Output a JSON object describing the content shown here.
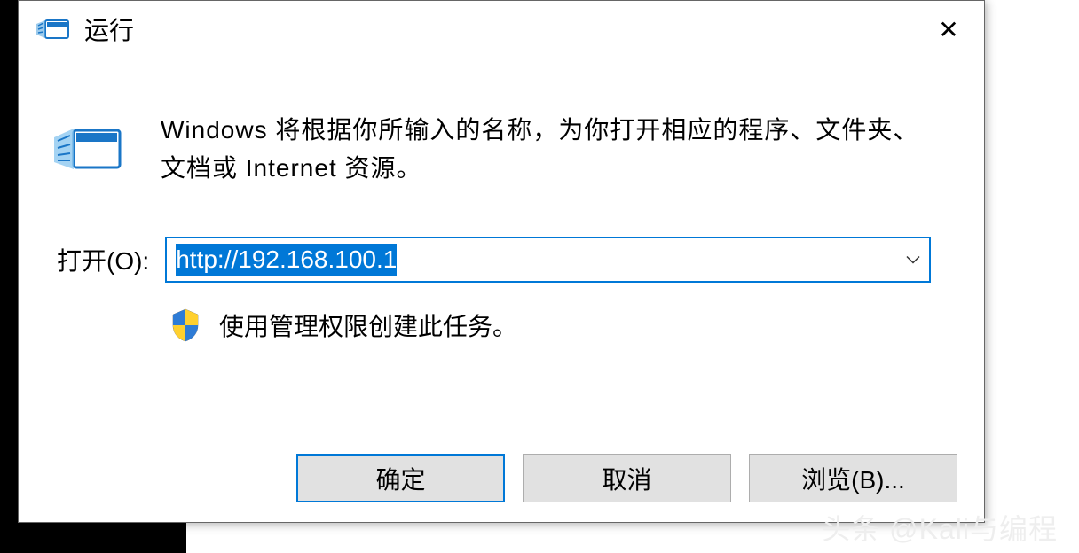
{
  "dialog": {
    "title": "运行",
    "close_symbol": "✕",
    "description": "Windows 将根据你所输入的名称，为你打开相应的程序、文件夹、文档或 Internet 资源。",
    "open_label": "打开(O):",
    "input_value": "http://192.168.100.1",
    "admin_note": "使用管理权限创建此任务。",
    "buttons": {
      "ok": "确定",
      "cancel": "取消",
      "browse": "浏览(B)..."
    }
  },
  "watermark": "头条 @Kali与编程"
}
